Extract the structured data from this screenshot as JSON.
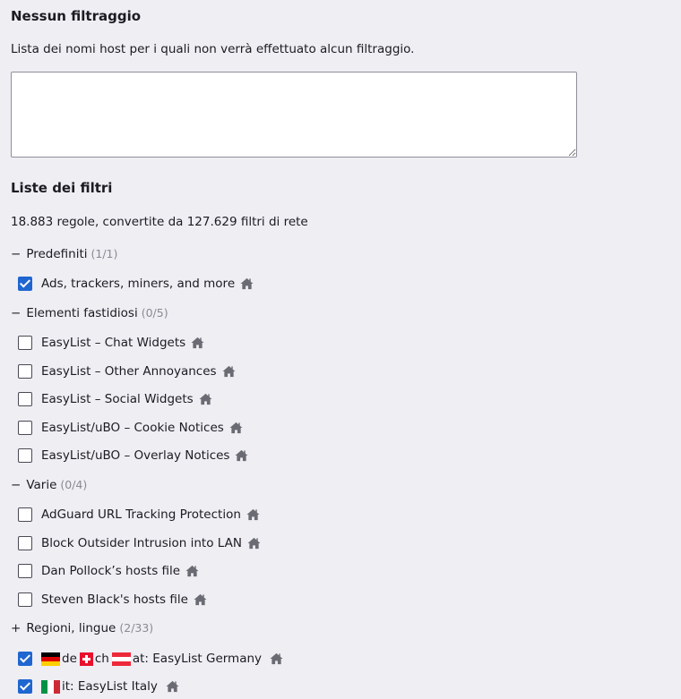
{
  "no_filtering": {
    "title": "Nessun filtraggio",
    "description": "Lista dei nomi host per i quali non verrà effettuato alcun filtraggio.",
    "hosts_value": ""
  },
  "filter_lists": {
    "title": "Liste dei filtri",
    "stats": "18.883 regole, convertite da 127.629 filtri di rete",
    "groups": [
      {
        "toggle": "−",
        "name": "Predefiniti",
        "count": "(1/1)",
        "items": [
          {
            "label": "Ads, trackers, miners, and more",
            "checked": true,
            "icon": "home-icon"
          }
        ]
      },
      {
        "toggle": "−",
        "name": "Elementi fastidiosi",
        "count": "(0/5)",
        "items": [
          {
            "label": "EasyList – Chat Widgets",
            "checked": false,
            "icon": "home-icon"
          },
          {
            "label": "EasyList – Other Annoyances",
            "checked": false,
            "icon": "home-icon"
          },
          {
            "label": "EasyList – Social Widgets",
            "checked": false,
            "icon": "home-icon"
          },
          {
            "label": "EasyList/uBO – Cookie Notices",
            "checked": false,
            "icon": "home-icon"
          },
          {
            "label": "EasyList/uBO – Overlay Notices",
            "checked": false,
            "icon": "home-icon"
          }
        ]
      },
      {
        "toggle": "−",
        "name": "Varie",
        "count": "(0/4)",
        "items": [
          {
            "label": "AdGuard URL Tracking Protection",
            "checked": false,
            "icon": "home-icon"
          },
          {
            "label": "Block Outsider Intrusion into LAN",
            "checked": false,
            "icon": "home-icon"
          },
          {
            "label": "Dan Pollock’s hosts file",
            "checked": false,
            "icon": "home-icon"
          },
          {
            "label": "Steven Black's hosts file",
            "checked": false,
            "icon": "home-icon"
          }
        ]
      },
      {
        "toggle": "+",
        "name": "Regioni, lingue",
        "count": "(2/33)",
        "items": [
          {
            "label_parts": [
              "de",
              "ch",
              "at: EasyList Germany"
            ],
            "flags": [
              "germany-flag-icon",
              "switzerland-flag-icon",
              "austria-flag-icon"
            ],
            "checked": true,
            "icon": "home-icon"
          },
          {
            "label_parts": [
              "it: EasyList Italy"
            ],
            "flags": [
              "italy-flag-icon"
            ],
            "checked": true,
            "icon": "home-icon"
          }
        ]
      }
    ]
  },
  "colors": {
    "background": "#efeef3",
    "checkbox_checked": "#1f66d0",
    "count_text": "#8a8a93",
    "home_icon": "#6b6b74"
  }
}
